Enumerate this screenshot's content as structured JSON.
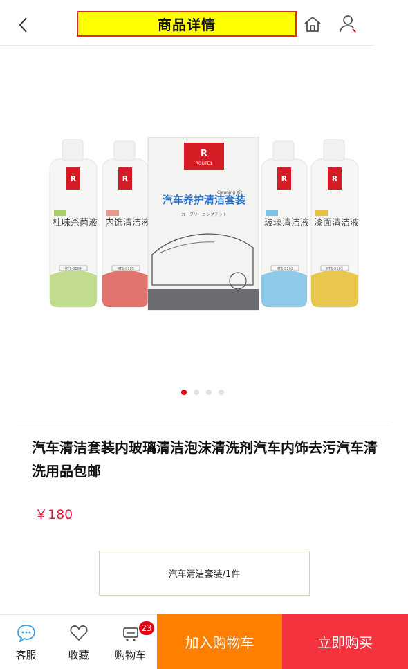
{
  "header": {
    "title": "商品详情"
  },
  "product": {
    "title": "汽车清洁套装内玻璃清洁泡沫清洗剂汽车内饰去污汽车清洗用品包邮",
    "price": "￥180",
    "spec": "汽车清洁套装/1件",
    "image": {
      "brand": "ROUTE1",
      "brand_cn": "资号线",
      "box_title_cn": "汽车养护清洁套装",
      "box_title_en": "Cleaning Kit",
      "box_sub": "カークリーニングチット",
      "bottles": [
        {
          "cn": "杜味杀菌液",
          "code": "RT1-0104",
          "net": "净含量：280ml",
          "tag": "环保型",
          "color": "#a9cf6a"
        },
        {
          "cn": "内饰清洁液",
          "code": "RT1-0105",
          "net": "净含量：280ml",
          "tag": "环保型",
          "color": "#dd5e56"
        },
        {
          "cn": "玻璃清洁液",
          "code": "RT1-0102",
          "net": "净含量：280ml",
          "tag": "环保型",
          "color": "#7cc2e8"
        },
        {
          "cn": "漆面清洁液",
          "code": "RT1-0103",
          "net": "净含量：280ml",
          "tag": "环保型",
          "color": "#e8c23c"
        }
      ]
    }
  },
  "gallery": {
    "dots": 4,
    "active": 0
  },
  "bottombar": {
    "service": "客服",
    "favorite": "收藏",
    "cart": "购物车",
    "cart_count": "23",
    "add_to_cart": "加入购物车",
    "buy_now": "立即购买"
  },
  "colors": {
    "accent_red": "#e60012",
    "price": "#e0163c",
    "orange": "#ff7f00",
    "buy": "#f5333f",
    "title_bg": "#ffff00"
  }
}
